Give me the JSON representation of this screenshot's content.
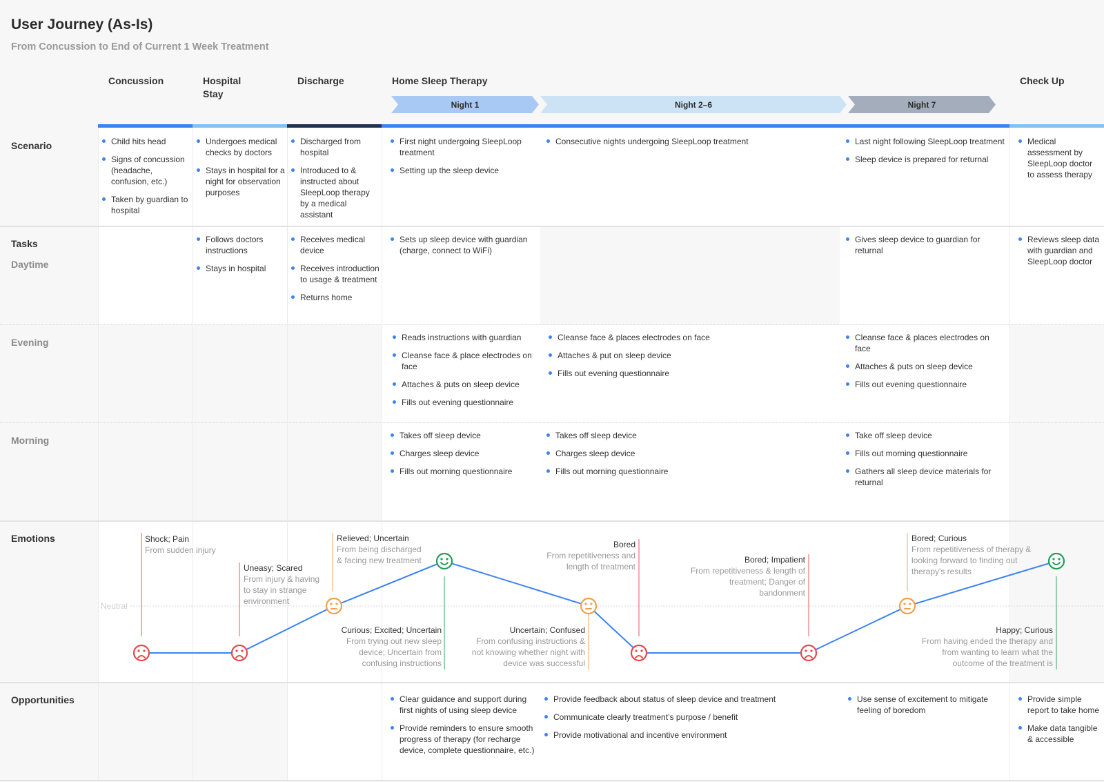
{
  "header": {
    "title": "User Journey (As-Is)",
    "subtitle": "From Concussion to End of Current 1 Week Treatment"
  },
  "phases": [
    {
      "label": "Concussion",
      "bar_color": "#3b82f6"
    },
    {
      "label": "Hospital Stay",
      "bar_color": "#85c1f0"
    },
    {
      "label": "Discharge",
      "bar_color": "#1e3352"
    },
    {
      "label": "Home Sleep Therapy",
      "bar_color": "#3b82f6"
    },
    {
      "label": "Check Up",
      "bar_color": "#85c1f0"
    }
  ],
  "nights": [
    {
      "label": "Night 1",
      "color": "#a9c9f5"
    },
    {
      "label": "Night 2–6",
      "color": "#cce3f5"
    },
    {
      "label": "Night 7",
      "color": "#a3adbb"
    }
  ],
  "rows": {
    "scenario": "Scenario",
    "tasks": "Tasks",
    "daytime": "Daytime",
    "evening": "Evening",
    "morning": "Morning",
    "emotions": "Emotions",
    "opportunities": "Opportunities"
  },
  "scenario": {
    "concussion": [
      "Child hits head",
      "Signs of concussion (headache, confusion, etc.)",
      "Taken by guardian to hospital"
    ],
    "hospital": [
      "Undergoes medical checks by doctors",
      "Stays in hospital for a night for observation purposes"
    ],
    "discharge": [
      "Discharged from hospital",
      "Introduced to & instructed about SleepLoop therapy by a medical assistant"
    ],
    "night1": [
      "First night undergoing SleepLoop treatment",
      "Setting up the sleep device"
    ],
    "night26": [
      "Consecutive nights undergoing SleepLoop treatment"
    ],
    "night7": [
      "Last night following SleepLoop treatment",
      "Sleep device is prepared for returnal"
    ],
    "checkup": [
      "Medical assessment by SleepLoop doctor to assess therapy"
    ]
  },
  "daytime": {
    "hospital": [
      "Follows doctors instructions",
      "Stays in hospital"
    ],
    "discharge": [
      "Receives medical device",
      "Receives introduction to usage & treatment",
      "Returns home"
    ],
    "night1": [
      "Sets up sleep device with guardian (charge, connect to WiFi)"
    ],
    "night7": [
      "Gives sleep device to guardian for returnal"
    ],
    "checkup": [
      "Reviews sleep data with guardian and SleepLoop doctor"
    ]
  },
  "evening": {
    "night1": [
      "Reads instructions with guardian",
      "Cleanse face & place electrodes on face",
      "Attaches & puts on sleep device",
      "Fills out evening questionnaire"
    ],
    "night26": [
      "Cleanse face & places electrodes on face",
      "Attaches & put on sleep device",
      "Fills out evening questionnaire"
    ],
    "night7": [
      "Cleanse face & places electrodes on face",
      "Attaches & puts on sleep device",
      "Fills out evening questionnaire"
    ]
  },
  "morning": {
    "night1": [
      "Takes off sleep device",
      "Charges sleep device",
      "Fills out morning questionnaire"
    ],
    "night26": [
      "Takes off sleep device",
      "Charges sleep device",
      "Fills out morning questionnaire"
    ],
    "night7": [
      "Take off sleep device",
      "Fills out morning questionnaire",
      "Gathers all sleep device materials for returnal"
    ]
  },
  "emotions": {
    "neutral_label": "Neutral",
    "line_color": "#3b82f6",
    "level_colors": {
      "negative": "#e5484d",
      "neutral": "#f0a04b",
      "positive": "#1f9d55"
    },
    "points": [
      {
        "level": "negative",
        "title": "Shock; Pain",
        "desc": "From sudden injury"
      },
      {
        "level": "negative",
        "title": "Uneasy; Scared",
        "desc": "From injury & having to stay in strange environment"
      },
      {
        "level": "neutral",
        "title": "Relieved; Uncertain",
        "desc": "From being discharged & facing new treatment"
      },
      {
        "level": "positive",
        "title": "Curious; Excited; Uncertain",
        "desc": "From trying out new sleep device; Uncertain from confusing instructions"
      },
      {
        "level": "neutral",
        "title": "Uncertain; Confused",
        "desc": "From confusing instructions & not knowing whether night with device was successful"
      },
      {
        "level": "negative",
        "title": "Bored",
        "desc": "From repetitiveness and length of treatment"
      },
      {
        "level": "negative",
        "title": "Bored; Impatient",
        "desc": "From repetitiveness & length of treatment; Danger of bandonment"
      },
      {
        "level": "neutral",
        "title": "Bored; Curious",
        "desc": "From repetitiveness of therapy & looking forward to finding out therapy's results"
      },
      {
        "level": "positive",
        "title": "Happy; Curious",
        "desc": "From having ended the therapy and from wanting to learn what the outcome of the treatment is"
      }
    ]
  },
  "opportunities": {
    "night1": [
      "Clear guidance and support during first nights of using sleep device",
      "Provide reminders to ensure smooth progress of therapy (for recharge device, complete questionnaire, etc.)"
    ],
    "night26": [
      "Provide feedback about status of sleep device and treatment",
      "Communicate clearly treatment’s purpose / benefit",
      "Provide motivational and incentive environment"
    ],
    "night7": [
      "Use sense of excitement to mitigate feeling of boredom"
    ],
    "checkup": [
      "Provide simple report to take home",
      "Make data tangible & accessible"
    ]
  }
}
